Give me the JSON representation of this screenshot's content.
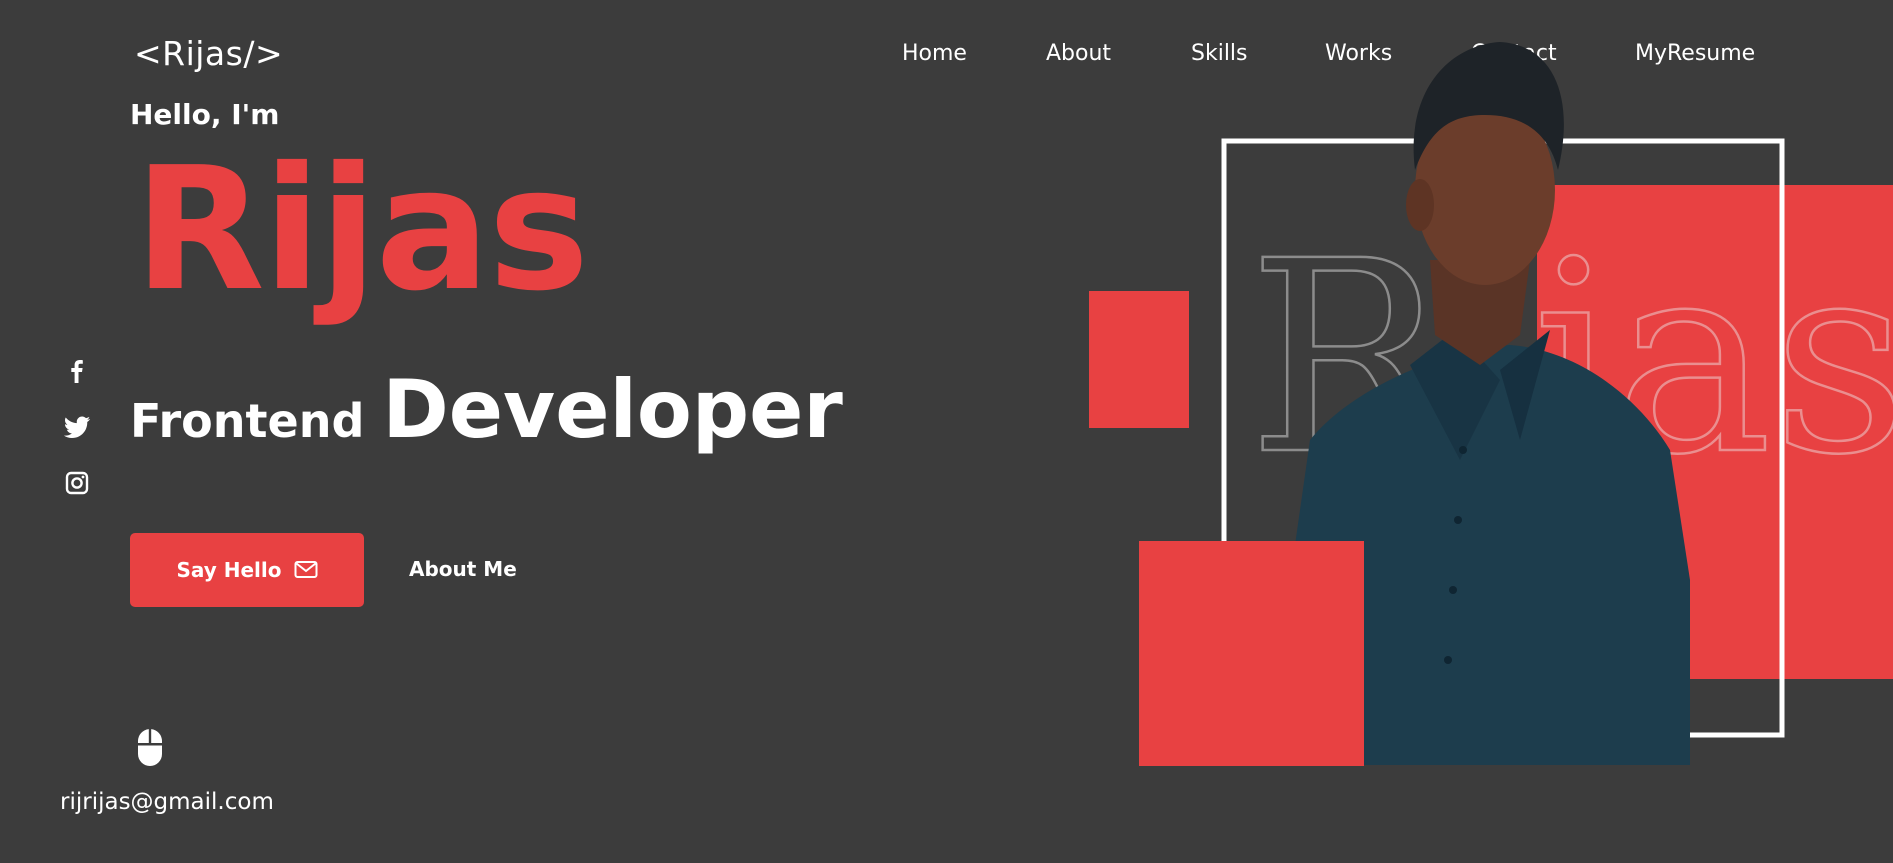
{
  "logo": "<Rijas/>",
  "nav": {
    "items": [
      "Home",
      "About",
      "Skills",
      "Works",
      "Contact",
      "MyResume"
    ]
  },
  "hero": {
    "greeting": "Hello, I'm",
    "name": "Rijas",
    "role_part1": "Frontend",
    "role_part2": "Developer",
    "outline_text": "Rijas"
  },
  "buttons": {
    "say_hello": "Say Hello",
    "about_me": "About Me"
  },
  "social": [
    "facebook-icon",
    "twitter-icon",
    "instagram-icon"
  ],
  "footer": {
    "email": "rijrijas@gmail.com"
  },
  "colors": {
    "background": "#3c3c3c",
    "accent": "#e84142",
    "text": "#ffffff",
    "shirt": "#1d3d4d"
  }
}
